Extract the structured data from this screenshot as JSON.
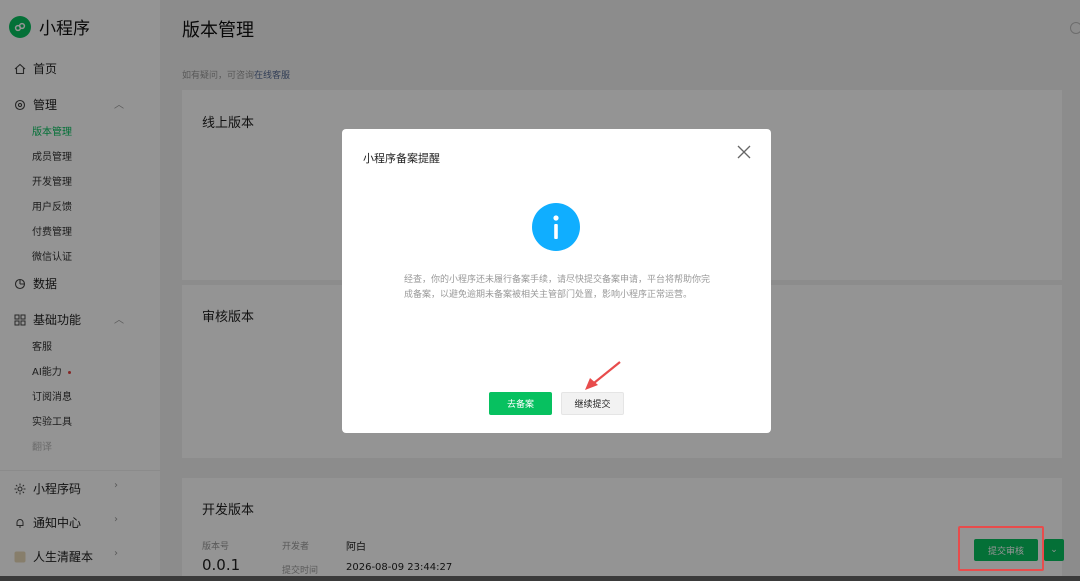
{
  "sidebar": {
    "app_title": "小程序",
    "home": "首页",
    "manage": "管理",
    "manage_items": [
      "版本管理",
      "成员管理",
      "开发管理",
      "用户反馈",
      "付费管理",
      "微信认证"
    ],
    "data": "数据",
    "basic": "基础功能",
    "basic_items": [
      "客服",
      "AI能力",
      "订阅消息",
      "实验工具",
      "翻译"
    ],
    "qrcode": "小程序码",
    "notify": "通知中心",
    "account": "人生清醒本"
  },
  "header": {
    "title": "版本管理",
    "help_prefix": "如有疑问，可咨询",
    "help_link": "在线客服"
  },
  "sections": {
    "online": "线上版本",
    "review": "审核版本",
    "dev": "开发版本"
  },
  "dev_version": {
    "version_label": "版本号",
    "version": "0.0.1",
    "developer_label": "开发者",
    "developer": "阿白",
    "submit_time_label": "提交时间",
    "submit_time": "2026-08-09 23:44:27",
    "submit_button": "提交审核"
  },
  "modal": {
    "title": "小程序备案提醒",
    "message": "经查，你的小程序还未履行备案手续，请尽快提交备案申请，平台将帮助你完成备案，以避免逾期未备案被相关主管部门处置，影响小程序正常运营。",
    "primary_button": "去备案",
    "secondary_button": "继续提交"
  },
  "colors": {
    "brand_green": "#07c160",
    "info_blue": "#10aeff",
    "annotation_red": "#e84c4c"
  }
}
